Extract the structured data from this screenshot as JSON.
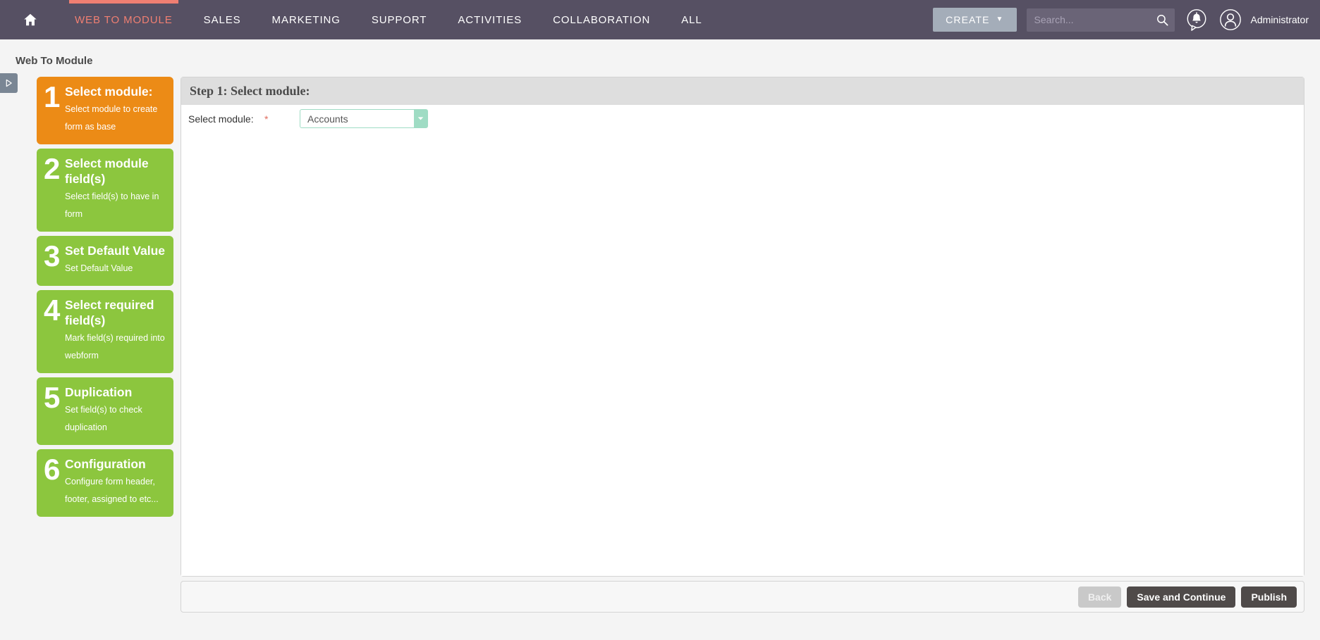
{
  "topnav": {
    "home_icon": "home-icon",
    "items": [
      {
        "label": "WEB TO MODULE",
        "active": true
      },
      {
        "label": "SALES",
        "active": false
      },
      {
        "label": "MARKETING",
        "active": false
      },
      {
        "label": "SUPPORT",
        "active": false
      },
      {
        "label": "ACTIVITIES",
        "active": false
      },
      {
        "label": "COLLABORATION",
        "active": false
      },
      {
        "label": "ALL",
        "active": false
      }
    ],
    "create_label": "CREATE",
    "create_caret": "▼",
    "search_placeholder": "Search...",
    "search_value": "",
    "search_icon": "search-icon",
    "notification_icon": "notification-bell-icon",
    "user_icon": "user-avatar-icon",
    "user_name": "Administrator",
    "accent_color": "#ef7f72",
    "bar_color": "#565063"
  },
  "sidebar_toggle": {
    "icon": "expand-sidebar-triangle-icon"
  },
  "page": {
    "title": "Web To Module"
  },
  "steps": [
    {
      "num": "1",
      "title": "Select module:",
      "desc": "Select module to create form as base",
      "state": "orange"
    },
    {
      "num": "2",
      "title": "Select module field(s)",
      "desc": "Select field(s) to have in form",
      "state": "green"
    },
    {
      "num": "3",
      "title": "Set Default Value",
      "desc": "Set Default Value",
      "state": "green"
    },
    {
      "num": "4",
      "title": "Select required field(s)",
      "desc": "Mark field(s) required into webform",
      "state": "green"
    },
    {
      "num": "5",
      "title": "Duplication",
      "desc": "Set field(s) to check duplication",
      "state": "green"
    },
    {
      "num": "6",
      "title": "Configuration",
      "desc": "Configure form header, footer, assigned to etc...",
      "state": "green"
    }
  ],
  "panel": {
    "heading": "Step 1: Select module:",
    "field_label": "Select module:",
    "required_marker": "*",
    "select_value": "Accounts",
    "select_arrow_icon": "chevron-down-icon"
  },
  "footer": {
    "back_label": "Back",
    "save_continue_label": "Save and Continue",
    "publish_label": "Publish"
  },
  "colors": {
    "step_active": "#ec8b16",
    "step_inactive": "#8cc63e",
    "select_border": "#9fdcc4",
    "required": "#e06c5e"
  }
}
